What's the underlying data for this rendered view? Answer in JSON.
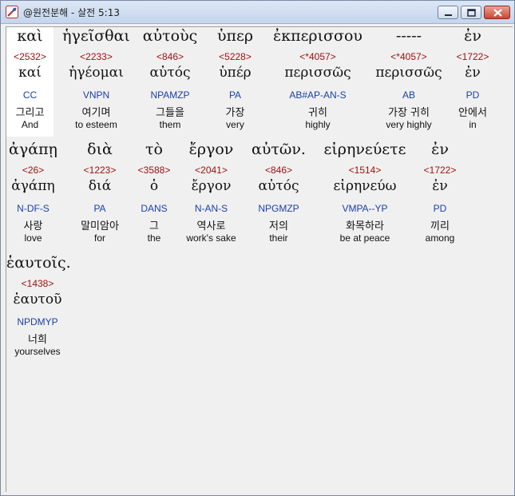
{
  "window": {
    "title": "@원전분해 - 살전 5:13"
  },
  "rows": [
    [
      {
        "greek": "καὶ",
        "num": "<2532>",
        "lemma": "καί",
        "parse": "CC",
        "kor": "그리고",
        "eng": "And"
      },
      {
        "greek": "ἡγεῖσθαι",
        "num": "<2233>",
        "lemma": "ἡγέομαι",
        "parse": "VNPN",
        "kor": "여기며",
        "eng": "to esteem"
      },
      {
        "greek": "αὐτοὺς",
        "num": "<846>",
        "lemma": "αὐτός",
        "parse": "NPAMZP",
        "kor": "그들을",
        "eng": "them"
      },
      {
        "greek": "ὑπερ",
        "num": "<5228>",
        "lemma": "ὑπέρ",
        "parse": "PA",
        "kor": "가장",
        "eng": "very"
      },
      {
        "greek": "ἐκπερισσου",
        "num": "<*4057>",
        "lemma": "περισσῶς",
        "parse": "AB#AP-AN-S",
        "kor": "귀히",
        "eng": "highly"
      },
      {
        "greek": "-----",
        "num": "<*4057>",
        "lemma": "περισσῶς",
        "parse": "AB",
        "kor": "가장 귀히",
        "eng": "very highly"
      },
      {
        "greek": "ἐν",
        "num": "<1722>",
        "lemma": "ἐν",
        "parse": "PD",
        "kor": "안에서",
        "eng": "in"
      }
    ],
    [
      {
        "greek": "ἀγάπῃ",
        "num": "<26>",
        "lemma": "ἀγάπη",
        "parse": "N-DF-S",
        "kor": "사랑",
        "eng": "love"
      },
      {
        "greek": "διὰ",
        "num": "<1223>",
        "lemma": "διά",
        "parse": "PA",
        "kor": "말미암아",
        "eng": "for"
      },
      {
        "greek": "τὸ",
        "num": "<3588>",
        "lemma": "ὁ",
        "parse": "DANS",
        "kor": "그",
        "eng": "the"
      },
      {
        "greek": "ἔργον",
        "num": "<2041>",
        "lemma": "ἔργον",
        "parse": "N-AN-S",
        "kor": "역사로",
        "eng": "work's sake"
      },
      {
        "greek": "αὐτῶν.",
        "num": "<846>",
        "lemma": "αὐτός",
        "parse": "NPGMZP",
        "kor": "저의",
        "eng": "their"
      },
      {
        "greek": "εἰρηνεύετε",
        "num": "<1514>",
        "lemma": "εἰρηνεύω",
        "parse": "VMPA--YP",
        "kor": "화목하라",
        "eng": "be at peace"
      },
      {
        "greek": "ἐν",
        "num": "<1722>",
        "lemma": "ἐν",
        "parse": "PD",
        "kor": "끼리",
        "eng": "among"
      }
    ],
    [
      {
        "greek": "ἑαυτοῖς.",
        "num": "<1438>",
        "lemma": "ἑαυτοῦ",
        "parse": "NPDMYP",
        "kor": "너희",
        "eng": "yourselves"
      }
    ]
  ]
}
